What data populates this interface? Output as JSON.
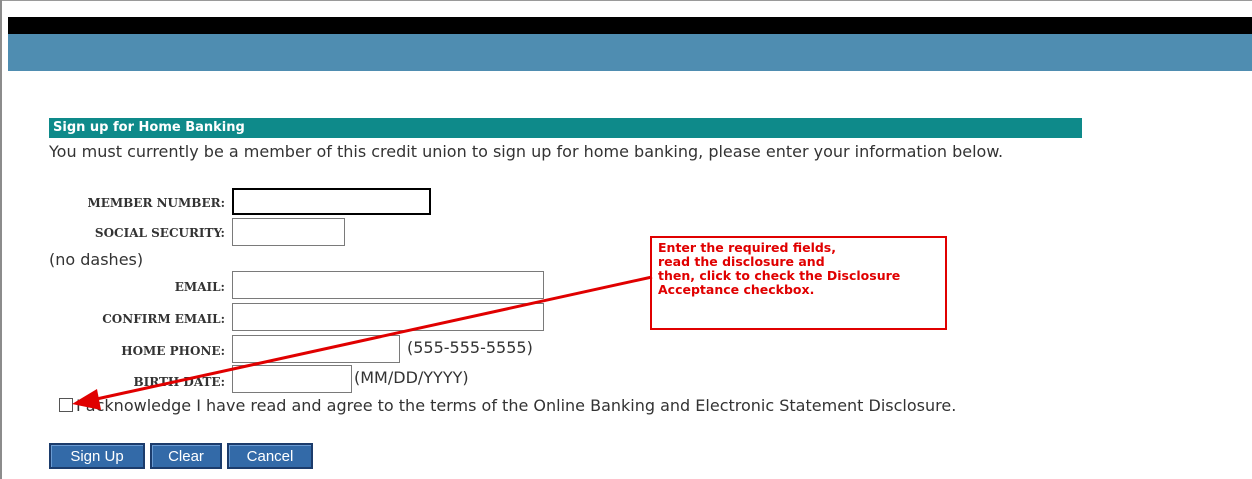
{
  "form": {
    "header": "Sign up for Home Banking",
    "intro": "You must currently be a member of this credit union to sign up for home banking, please enter your information below.",
    "fields": {
      "member_number": {
        "label": "MEMBER NUMBER:",
        "value": ""
      },
      "social_security": {
        "label": "SOCIAL SECURITY:",
        "value": "",
        "note": "(no dashes)"
      },
      "email": {
        "label": "EMAIL:",
        "value": ""
      },
      "confirm_email": {
        "label": "CONFIRM EMAIL:",
        "value": ""
      },
      "home_phone": {
        "label": "HOME PHONE:",
        "value": "",
        "format_hint": "(555-555-5555)"
      },
      "birth_date": {
        "label": "BIRTH DATE:",
        "value": "",
        "format_hint": "(MM/DD/YYYY)"
      }
    },
    "disclosure": {
      "label": "I acknowledge I have read and agree to the terms of the Online Banking and Electronic Statement Disclosure.",
      "checked": false
    },
    "buttons": {
      "sign_up": "Sign Up",
      "clear": "Clear",
      "cancel": "Cancel"
    }
  },
  "callout": {
    "lines": [
      "Enter the required fields,",
      "read the disclosure and",
      "then, click to check the Disclosure",
      "Acceptance checkbox."
    ]
  },
  "colors": {
    "header_band": "#4f8db1",
    "section_header": "#0e8a8a",
    "button": "#336aa8",
    "callout": "#e00000"
  }
}
